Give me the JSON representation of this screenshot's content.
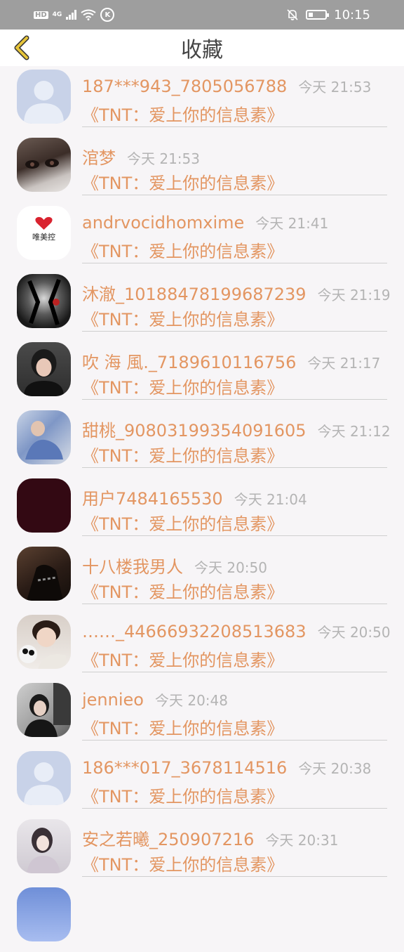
{
  "status_bar": {
    "hd": "HD",
    "signal": "4G",
    "time": "10:15",
    "icons": [
      "hd-icon",
      "signal-icon",
      "wifi-icon",
      "k-icon",
      "mute-icon",
      "battery-icon"
    ]
  },
  "header": {
    "back_icon": "chevron-left-icon",
    "title": "收藏"
  },
  "items": [
    {
      "name": "187***943_7805056788",
      "time": "今天 21:53",
      "title": "《TNT：爱上你的信息素》",
      "avatar": "default-avatar"
    },
    {
      "name": "涫梦",
      "time": "今天 21:53",
      "title": "《TNT：爱上你的信息素》",
      "avatar": "photo-eyes"
    },
    {
      "name": "andrvocidhomxime",
      "time": "今天 21:41",
      "title": "《TNT：爱上你的信息素》",
      "avatar": "logo",
      "avatar_text": "唯美控"
    },
    {
      "name": "沐澈_10188478199687239",
      "time": "今天 21:19",
      "title": "《TNT：爱上你的信息素》",
      "avatar": "photo-dark"
    },
    {
      "name": "吹 海 風._7189610116756",
      "time": "今天 21:17",
      "title": "《TNT：爱上你的信息素》",
      "avatar": "photo-girl"
    },
    {
      "name": "甜桃_90803199354091605",
      "time": "今天 21:12",
      "title": "《TNT：爱上你的信息素》",
      "avatar": "photo-blue"
    },
    {
      "name": "用户7484165530",
      "time": "今天 21:04",
      "title": "《TNT：爱上你的信息素》",
      "avatar": "solid"
    },
    {
      "name": "十八楼我男人",
      "time": "今天 20:50",
      "title": "《TNT：爱上你的信息素》",
      "avatar": "photo-shadow"
    },
    {
      "name": "……_44666932208513683",
      "time": "今天 20:50",
      "title": "《TNT：爱上你的信息素》",
      "avatar": "photo-plush"
    },
    {
      "name": "jennieo",
      "time": "今天 20:48",
      "title": "《TNT：爱上你的信息素》",
      "avatar": "photo-room"
    },
    {
      "name": "186***017_3678114516",
      "time": "今天 20:38",
      "title": "《TNT：爱上你的信息素》",
      "avatar": "default-avatar"
    },
    {
      "name": "安之若曦_250907216",
      "time": "今天 20:31",
      "title": "《TNT：爱上你的信息素》",
      "avatar": "photo-light"
    }
  ],
  "colors": {
    "accent": "#e39662",
    "back_icon": "#e6c43a",
    "time": "#b4b4b4"
  }
}
